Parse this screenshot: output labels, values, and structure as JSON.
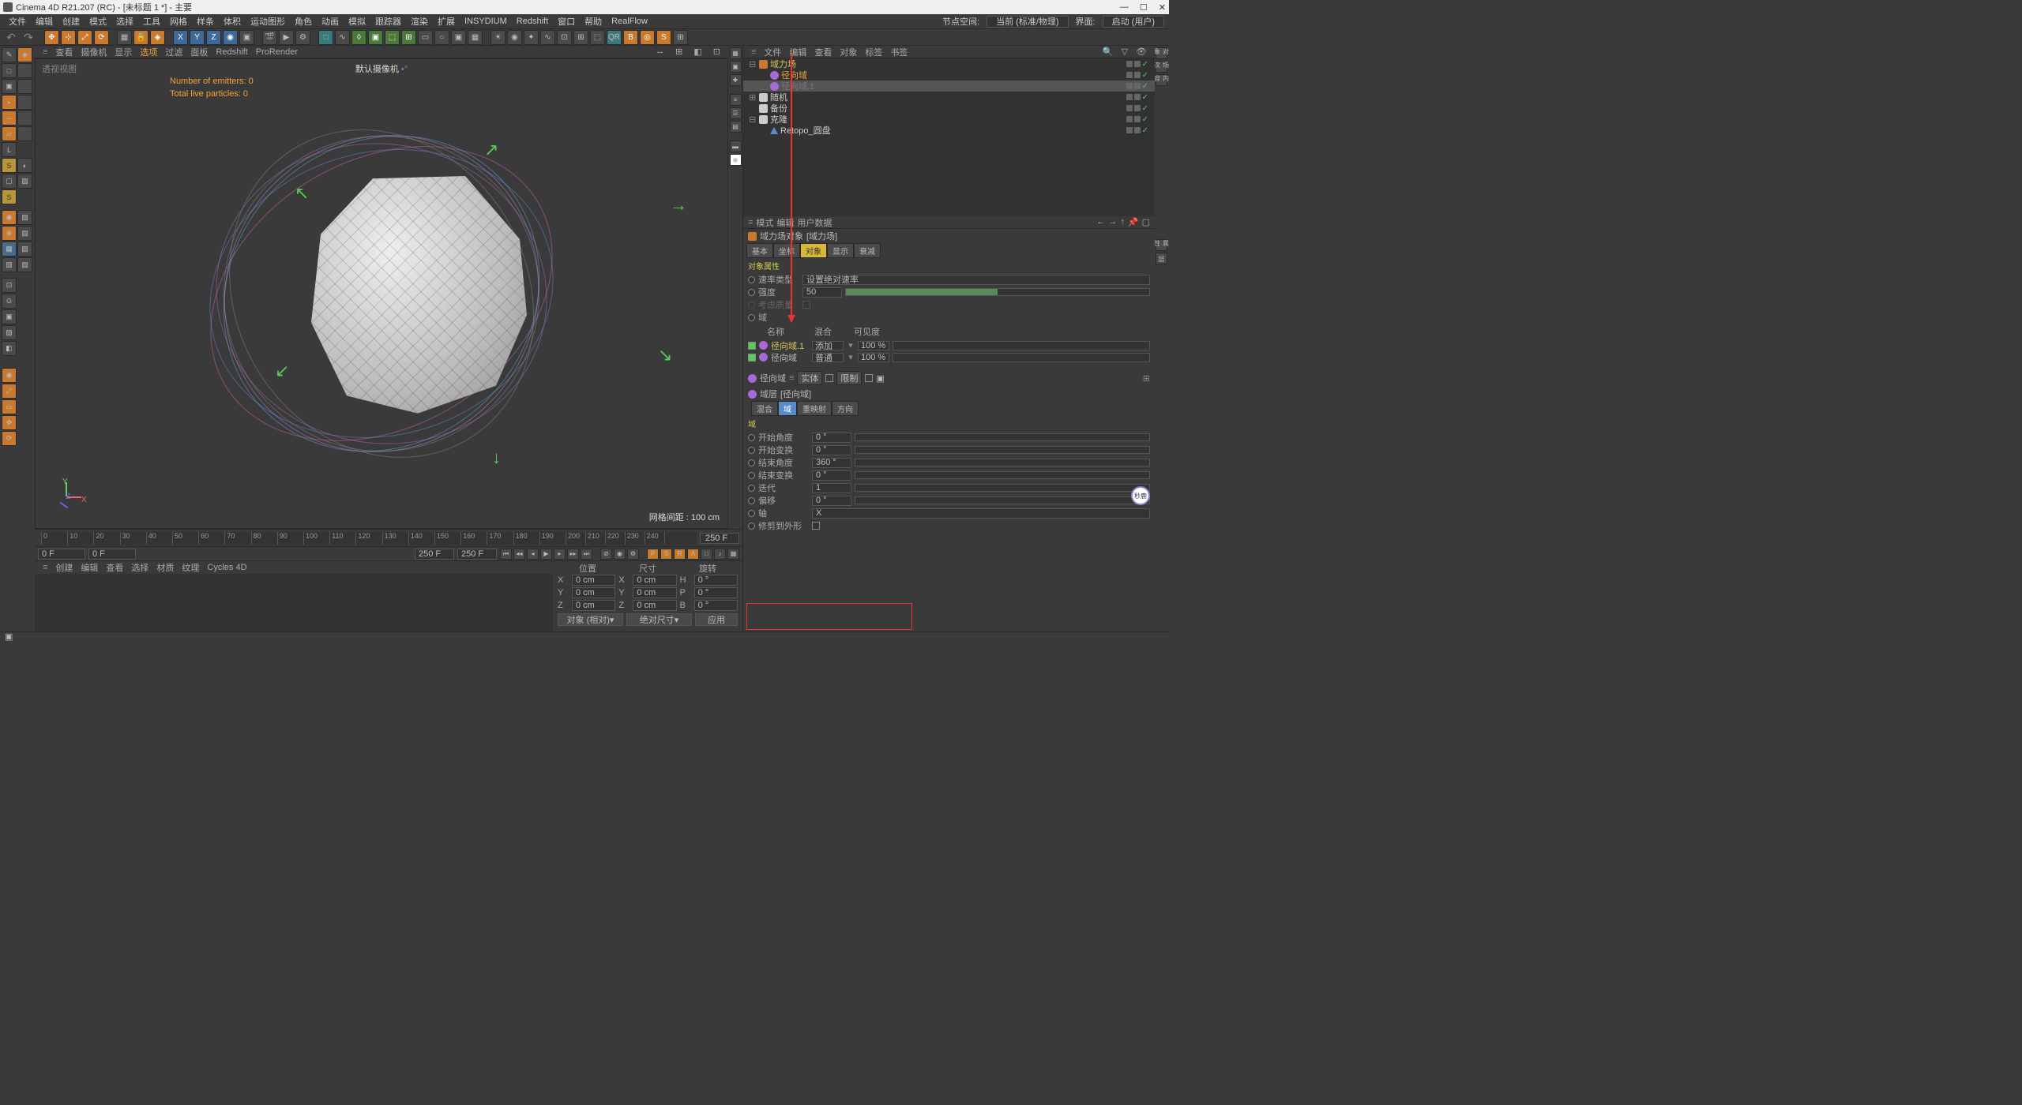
{
  "app": {
    "title": "Cinema 4D R21.207 (RC) - [未标题 1 *] - 主要",
    "window_min": "—",
    "window_max": "☐",
    "window_close": "✕"
  },
  "menu": {
    "items": [
      "文件",
      "编辑",
      "创建",
      "模式",
      "选择",
      "工具",
      "网格",
      "样条",
      "体积",
      "运动图形",
      "角色",
      "动画",
      "模拟",
      "跟踪器",
      "渲染",
      "扩展",
      "INSYDIUM",
      "Redshift",
      "窗口",
      "帮助",
      "RealFlow"
    ],
    "right_label1": "节点空间:",
    "right_val1": "当前 (标准/物理)",
    "right_label2": "界面:",
    "right_val2": "启动 (用户)"
  },
  "viewport": {
    "menu": [
      "查看",
      "摄像机",
      "显示",
      "选项",
      "过滤",
      "面板",
      "Redshift",
      "ProRender"
    ],
    "label": "透视视图",
    "camera": "默认摄像机",
    "stat1": "Number of emitters: 0",
    "stat2": "Total live particles: 0",
    "grid_label": "网格间距 : 100 cm"
  },
  "timeline": {
    "start": "0 F",
    "cur": "0 F",
    "end": "250 F",
    "end2": "250 F",
    "ruler_end": "250 F"
  },
  "bottom": {
    "menu": [
      "创建",
      "编辑",
      "查看",
      "选择",
      "材质",
      "纹理",
      "Cycles 4D"
    ]
  },
  "coords": {
    "headers": [
      "位置",
      "尺寸",
      "旋转"
    ],
    "rows": [
      {
        "a": "X",
        "v1": "0 cm",
        "b": "X",
        "v2": "0 cm",
        "c": "H",
        "v3": "0 °"
      },
      {
        "a": "Y",
        "v1": "0 cm",
        "b": "Y",
        "v2": "0 cm",
        "c": "P",
        "v3": "0 °"
      },
      {
        "a": "Z",
        "v1": "0 cm",
        "b": "Z",
        "v2": "0 cm",
        "c": "B",
        "v3": "0 °"
      }
    ],
    "mode1": "对象 (相对)",
    "mode2": "绝对尺寸",
    "apply": "应用"
  },
  "obj_panel": {
    "menu": [
      "文件",
      "编辑",
      "查看",
      "对象",
      "标签",
      "书签"
    ],
    "tree": [
      {
        "indent": 0,
        "exp": "⊟",
        "icon": "orange-sq",
        "name": "域力场",
        "cls": "yellow"
      },
      {
        "indent": 1,
        "exp": "",
        "icon": "purple",
        "name": "径向域",
        "cls": "orange"
      },
      {
        "indent": 1,
        "exp": "",
        "icon": "purple",
        "name": "径向域.1",
        "cls": "disabled",
        "sel": true
      },
      {
        "indent": 0,
        "exp": "⊞",
        "icon": "white-sq",
        "name": "随机",
        "cls": ""
      },
      {
        "indent": 0,
        "exp": "",
        "icon": "white-sq",
        "name": "备份",
        "cls": ""
      },
      {
        "indent": 0,
        "exp": "⊟",
        "icon": "white-sq",
        "name": "克隆",
        "cls": ""
      },
      {
        "indent": 1,
        "exp": "",
        "icon": "blue-tri",
        "name": "Retopo_圆盘",
        "cls": ""
      }
    ]
  },
  "attr": {
    "menu": [
      "模式",
      "编辑",
      "用户数据"
    ],
    "title_icon_label": "域力场对象",
    "title_bracket": "[域力场]",
    "tabs": [
      "基本",
      "坐标",
      "对象",
      "显示",
      "衰减"
    ],
    "section": "对象属性",
    "rate_label": "速率类型",
    "rate_val": "设置绝对速率",
    "strength_label": "强度",
    "strength_val": "50",
    "mass_label": "考虑质量",
    "domain_label": "域",
    "list_head": [
      "名称",
      "混合",
      "可见度"
    ],
    "list": [
      {
        "name": "径向域.1",
        "mode": "添加",
        "vis": "100 %",
        "cls": "yellow"
      },
      {
        "name": "径向域",
        "mode": "普通",
        "vis": "100 %",
        "cls": ""
      }
    ],
    "sub_title": "径向域",
    "sub_tags": [
      "实体",
      "限制"
    ],
    "layer_label": "域层",
    "layer_bracket": "[径向域]",
    "layer_tabs": [
      "混合",
      "域",
      "重映射",
      "方向"
    ],
    "section2": "域",
    "fields": [
      {
        "label": "开始角度",
        "val": "0 °",
        "slider": true
      },
      {
        "label": "开始变换",
        "val": "0 °",
        "slider": true
      },
      {
        "label": "结束角度",
        "val": "360 °",
        "slider": true
      },
      {
        "label": "结束变换",
        "val": "0 °",
        "slider": true
      },
      {
        "label": "迭代",
        "val": "1",
        "slider": true
      },
      {
        "label": "偏移",
        "val": "0 °",
        "slider": true
      },
      {
        "label": "轴",
        "val": "X",
        "combo": true
      },
      {
        "label": "修剪到外形",
        "checkbox": true
      }
    ]
  }
}
